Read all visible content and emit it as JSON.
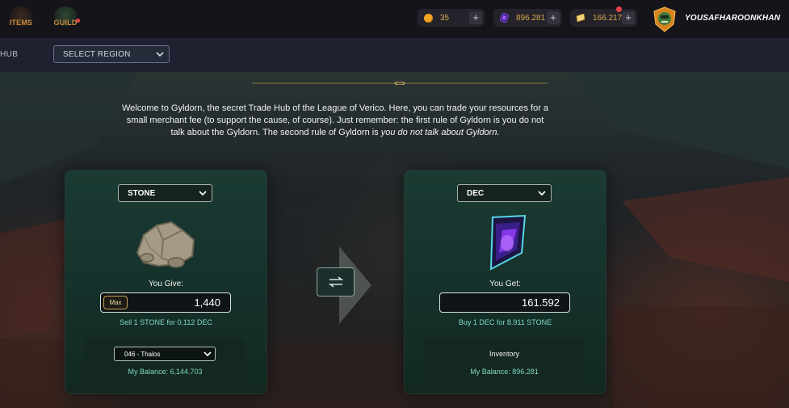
{
  "nav": {
    "items_label": "ITEMS",
    "guild_label": "GUILD"
  },
  "resources": {
    "gold": "35",
    "dec": "896.281",
    "voucher": "166.217"
  },
  "user": {
    "name": "YOUSAFHAROONKHAN"
  },
  "subnav": {
    "hub_label": "HUB",
    "region_select": "SELECT REGION"
  },
  "intro": {
    "text": "Welcome to Gyldorn, the secret Trade Hub of the League of Verico. Here, you can trade your resources for a small merchant fee (to support the cause, of course). Just remember: the first rule of Gyldorn is you do not talk about the Gyldorn. The second rule of Gyldorn is ",
    "emphasis": "you do not talk about Gyldorn."
  },
  "give": {
    "resource": "STONE",
    "label": "You Give:",
    "max_label": "Max",
    "amount": "1,440",
    "rate": "Sell 1 STONE for 0.112 DEC",
    "realm": "046 - Thalos",
    "balance": "My Balance: 6,144.703"
  },
  "get": {
    "resource": "DEC",
    "label": "You Get:",
    "amount": "161.592",
    "rate": "Buy 1 DEC for 8.911 STONE",
    "inventory_label": "Inventory",
    "balance": "My Balance: 896.281"
  },
  "icons": {
    "gold": "gold-coin-icon",
    "dec": "dec-crystal-icon",
    "voucher": "voucher-icon",
    "swap": "swap-arrows-icon"
  },
  "colors": {
    "accent_gold": "#d7a84a",
    "teal_text": "#7fd8c8",
    "panel_bg": "#1a3b33",
    "notification": "#e8424a"
  }
}
